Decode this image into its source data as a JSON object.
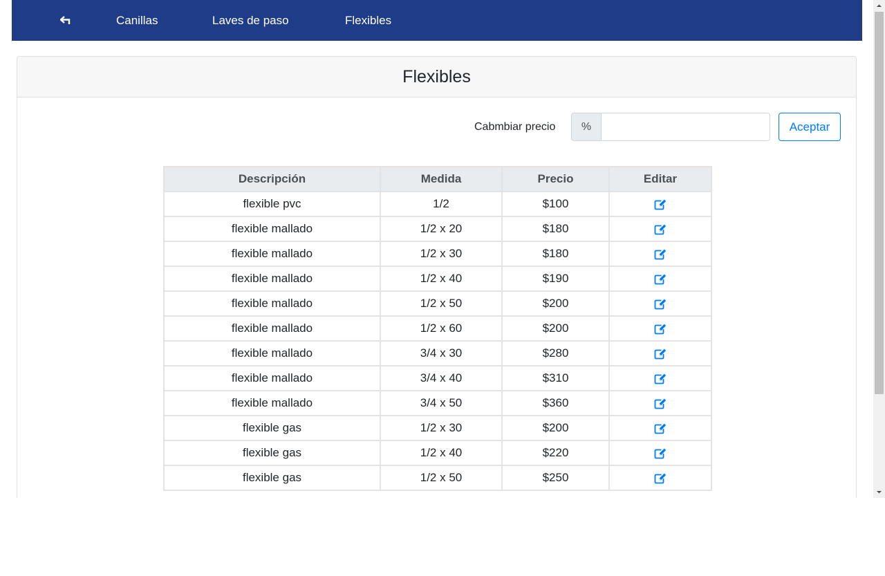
{
  "nav": {
    "back_icon": "return-arrow-icon",
    "links": [
      "Canillas",
      "Laves de paso",
      "Flexibles"
    ]
  },
  "card": {
    "title": "Flexibles"
  },
  "price_change": {
    "label": "Cabmbiar precio",
    "addon": "%",
    "value": "",
    "button": "Aceptar"
  },
  "table": {
    "headers": [
      "Descripción",
      "Medida",
      "Precio",
      "Editar"
    ],
    "edit_icon": "edit-icon",
    "rows": [
      {
        "descripcion": "flexible pvc",
        "medida": "1/2",
        "precio": "$100"
      },
      {
        "descripcion": "flexible mallado",
        "medida": "1/2 x 20",
        "precio": "$180"
      },
      {
        "descripcion": "flexible mallado",
        "medida": "1/2 x 30",
        "precio": "$180"
      },
      {
        "descripcion": "flexible mallado",
        "medida": "1/2 x 40",
        "precio": "$190"
      },
      {
        "descripcion": "flexible mallado",
        "medida": "1/2 x 50",
        "precio": "$200"
      },
      {
        "descripcion": "flexible mallado",
        "medida": "1/2 x 60",
        "precio": "$200"
      },
      {
        "descripcion": "flexible mallado",
        "medida": "3/4 x 30",
        "precio": "$280"
      },
      {
        "descripcion": "flexible mallado",
        "medida": "3/4 x 40",
        "precio": "$310"
      },
      {
        "descripcion": "flexible mallado",
        "medida": "3/4 x 50",
        "precio": "$360"
      },
      {
        "descripcion": "flexible gas",
        "medida": "1/2 x 30",
        "precio": "$200"
      },
      {
        "descripcion": "flexible gas",
        "medida": "1/2 x 40",
        "precio": "$220"
      },
      {
        "descripcion": "flexible gas",
        "medida": "1/2 x 50",
        "precio": "$250"
      }
    ]
  },
  "colors": {
    "navbar": "#1f3c88",
    "accent": "#007bff"
  }
}
